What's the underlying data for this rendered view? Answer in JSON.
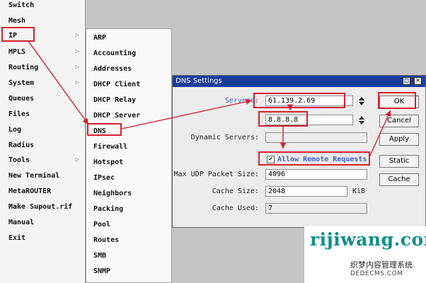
{
  "main_menu": {
    "items": [
      {
        "label": "Switch",
        "has_submenu": false
      },
      {
        "label": "Mesh",
        "has_submenu": false
      },
      {
        "label": "IP",
        "has_submenu": true
      },
      {
        "label": "MPLS",
        "has_submenu": true
      },
      {
        "label": "Routing",
        "has_submenu": true
      },
      {
        "label": "System",
        "has_submenu": true
      },
      {
        "label": "Queues",
        "has_submenu": false
      },
      {
        "label": "Files",
        "has_submenu": false
      },
      {
        "label": "Log",
        "has_submenu": false
      },
      {
        "label": "Radius",
        "has_submenu": false
      },
      {
        "label": "Tools",
        "has_submenu": true
      },
      {
        "label": "New Terminal",
        "has_submenu": false
      },
      {
        "label": "MetaROUTER",
        "has_submenu": false
      },
      {
        "label": "Make Supout.rif",
        "has_submenu": false
      },
      {
        "label": "Manual",
        "has_submenu": false
      },
      {
        "label": "Exit",
        "has_submenu": false
      }
    ],
    "arrow_glyph": "▷"
  },
  "ip_submenu": {
    "items": [
      "ARP",
      "Accounting",
      "Addresses",
      "DHCP Client",
      "DHCP Relay",
      "DHCP Server",
      "DNS",
      "Firewall",
      "Hotspot",
      "IPsec",
      "Neighbors",
      "Packing",
      "Pool",
      "Routes",
      "SMB",
      "SNMP"
    ]
  },
  "dns_window": {
    "title": "DNS Settings",
    "servers_label": "Servers:",
    "server_1": "61.139.2.69",
    "server_2": "8.8.8.8",
    "dynamic_servers_label": "Dynamic Servers:",
    "dynamic_servers_value": "",
    "allow_remote_label": "Allow Remote Requests",
    "allow_remote_checked": "✔",
    "max_udp_label": "Max UDP Packet Size:",
    "max_udp_value": "4096",
    "cache_size_label": "Cache Size:",
    "cache_size_value": "2048",
    "cache_size_unit": "KiB",
    "cache_used_label": "Cache Used:",
    "cache_used_value": "7",
    "buttons": {
      "ok": "OK",
      "cancel": "Cancel",
      "apply": "Apply",
      "static": "Static",
      "cache": "Cache"
    },
    "titlebar_buttons": {
      "restore": "□",
      "close": "×"
    }
  },
  "watermark": {
    "main": "rijiwang.com",
    "cn": "织梦内容管理系统",
    "sub": "DEDECMS.COM"
  },
  "colors": {
    "highlight": "#d8202a",
    "titlebar": "#1a3d9c",
    "watermark": "#0d8f8b"
  }
}
